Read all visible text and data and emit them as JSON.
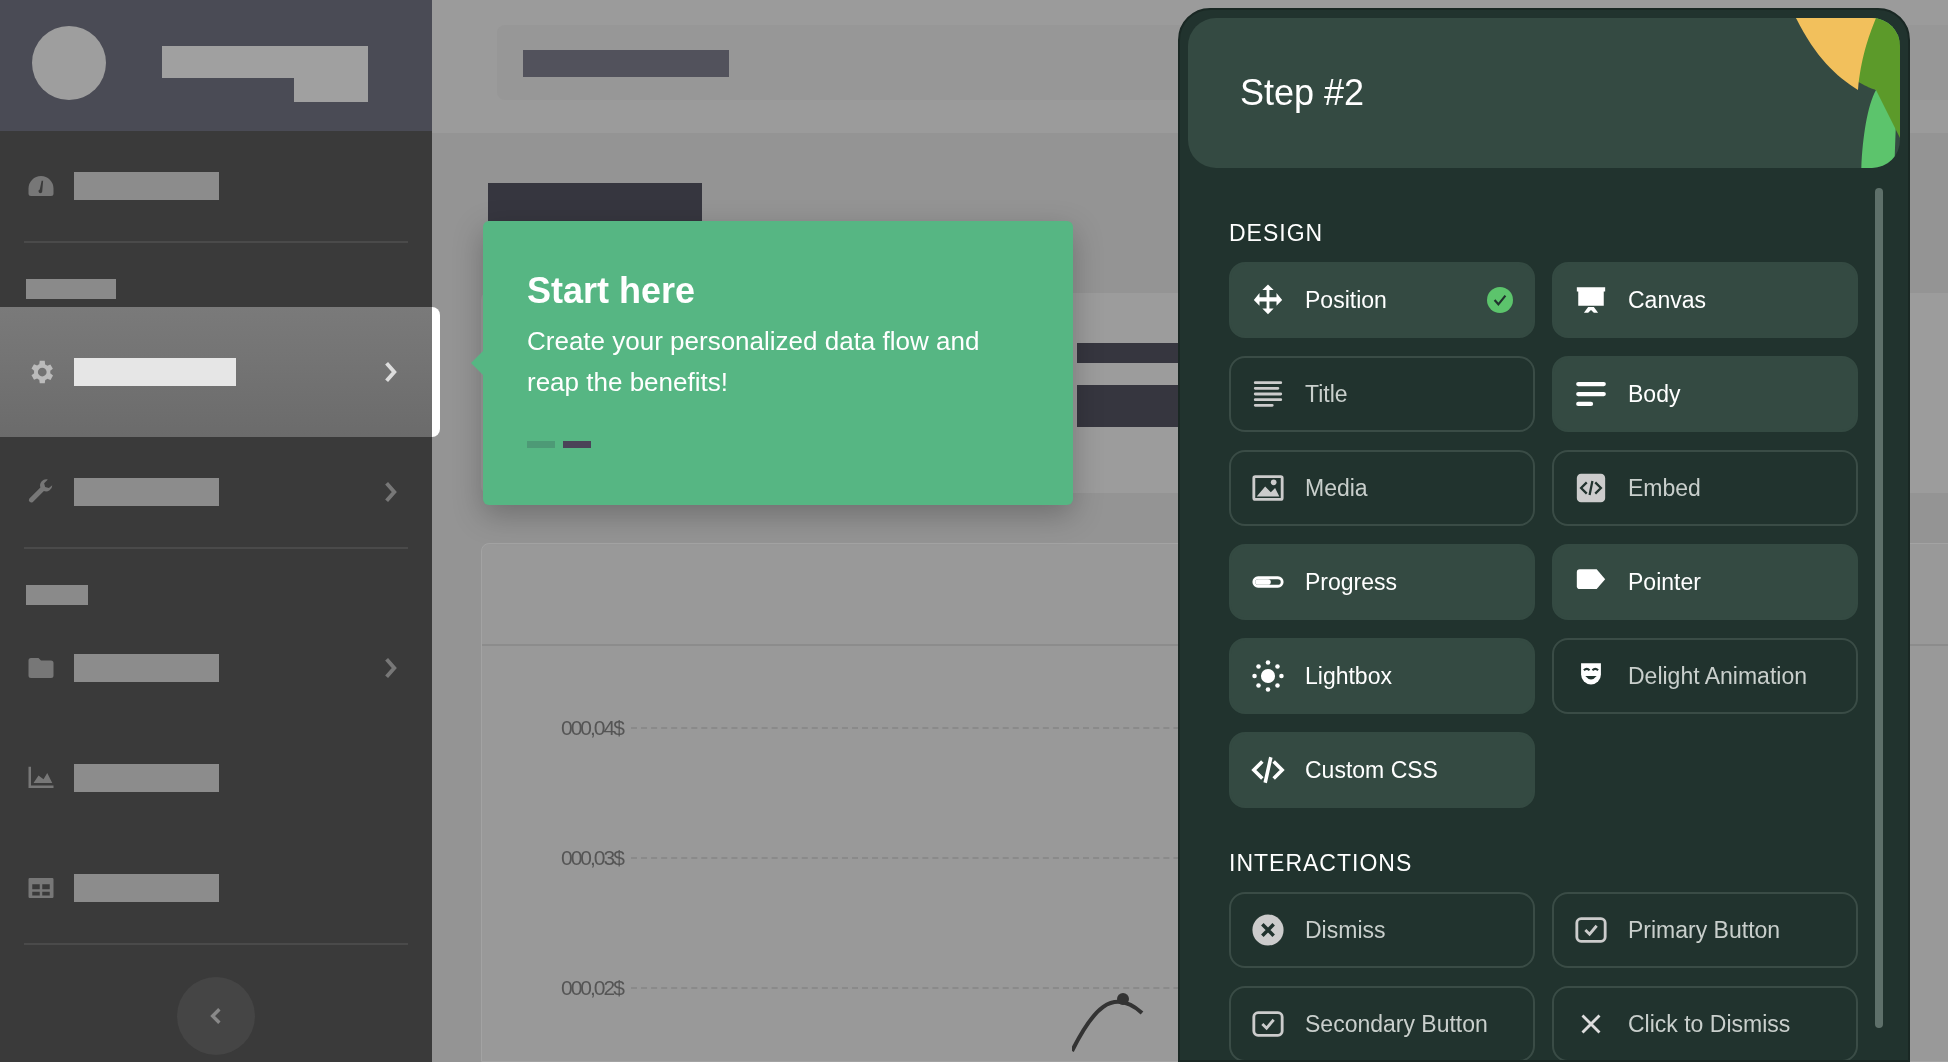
{
  "sidebar": {
    "sections": [
      {
        "heading": false,
        "items": [
          {
            "selected": false,
            "expandable": false
          }
        ]
      },
      {
        "heading": true,
        "items": [
          {
            "selected": true,
            "expandable": true
          },
          {
            "selected": false,
            "expandable": true
          }
        ]
      },
      {
        "heading": true,
        "items": [
          {
            "selected": false,
            "expandable": true
          },
          {
            "selected": false,
            "expandable": false
          },
          {
            "selected": false,
            "expandable": false
          }
        ]
      }
    ]
  },
  "chart": {
    "y_labels": [
      "000,04$",
      "000,03$",
      "000,02$"
    ]
  },
  "tooltip": {
    "title": "Start here",
    "body": "Create your personalized data flow and reap the benefits!",
    "steps": [
      {
        "selected": false
      },
      {
        "selected": true
      }
    ]
  },
  "panel": {
    "title": "Step #2",
    "sections": [
      {
        "heading": "DESIGN",
        "items": [
          {
            "label": "Position",
            "active": true,
            "checked": true
          },
          {
            "label": "Canvas",
            "active": true,
            "checked": false
          },
          {
            "label": "Title",
            "active": false,
            "checked": false
          },
          {
            "label": "Body",
            "active": true,
            "checked": false
          },
          {
            "label": "Media",
            "active": false,
            "checked": false
          },
          {
            "label": "Embed",
            "active": false,
            "checked": false
          },
          {
            "label": "Progress",
            "active": true,
            "checked": false
          },
          {
            "label": "Pointer",
            "active": true,
            "checked": false
          },
          {
            "label": "Lightbox",
            "active": true,
            "checked": false
          },
          {
            "label": "Delight Animation",
            "active": false,
            "checked": false
          },
          {
            "label": "Custom CSS",
            "active": true,
            "checked": false
          }
        ]
      },
      {
        "heading": "INTERACTIONS",
        "items": [
          {
            "label": "Dismiss",
            "active": false,
            "checked": false
          },
          {
            "label": "Primary Button",
            "active": false,
            "checked": false
          },
          {
            "label": "Secondary Button",
            "active": false,
            "checked": false
          },
          {
            "label": "Click to Dismiss",
            "active": false,
            "checked": false
          }
        ]
      }
    ]
  }
}
